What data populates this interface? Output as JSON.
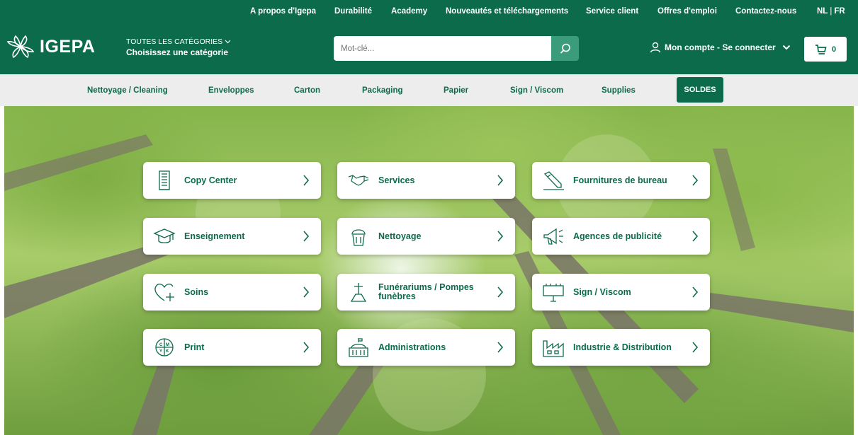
{
  "topbar": {
    "links": [
      "A propos d'Igepa",
      "Durabilité",
      "Academy",
      "Nouveautés et téléchargements",
      "Service client",
      "Offres d'emploi",
      "Contactez-nous"
    ],
    "lang_nl": "NL",
    "lang_sep": "|",
    "lang_fr": "FR"
  },
  "header": {
    "logo_text": "IGEPA",
    "category_small": "TOUTES LES CATÉGORIES",
    "category_big": "Choisissez une catégorie",
    "search_placeholder": "Mot-clé...",
    "account_label": "Mon compte - Se connecter",
    "cart_count": "0"
  },
  "catnav": {
    "items": [
      "Nettoyage / Cleaning",
      "Enveloppes",
      "Carton",
      "Packaging",
      "Papier",
      "Sign / Viscom",
      "Supplies"
    ],
    "sale_label": "SOLDES"
  },
  "tiles": [
    {
      "label": "Copy Center",
      "icon": "copier-icon"
    },
    {
      "label": "Services",
      "icon": "handshake-icon"
    },
    {
      "label": "Fournitures de bureau",
      "icon": "pencil-icon"
    },
    {
      "label": "Enseignement",
      "icon": "graduation-cap-icon"
    },
    {
      "label": "Nettoyage",
      "icon": "cleaning-bucket-icon"
    },
    {
      "label": "Agences de publicité",
      "icon": "megaphone-icon"
    },
    {
      "label": "Soins",
      "icon": "heart-plus-icon"
    },
    {
      "label": "Funérariums / Pompes funèbres",
      "icon": "cross-grave-icon"
    },
    {
      "label": "Sign / Viscom",
      "icon": "billboard-icon"
    },
    {
      "label": "Print",
      "icon": "cmyk-icon"
    },
    {
      "label": "Administrations",
      "icon": "building-icon"
    },
    {
      "label": "Industrie & Distribution",
      "icon": "factory-icon"
    }
  ],
  "colors": {
    "brand_green": "#0c6b4b",
    "search_button": "#3a9c7a",
    "nav_bg": "#ededed"
  }
}
